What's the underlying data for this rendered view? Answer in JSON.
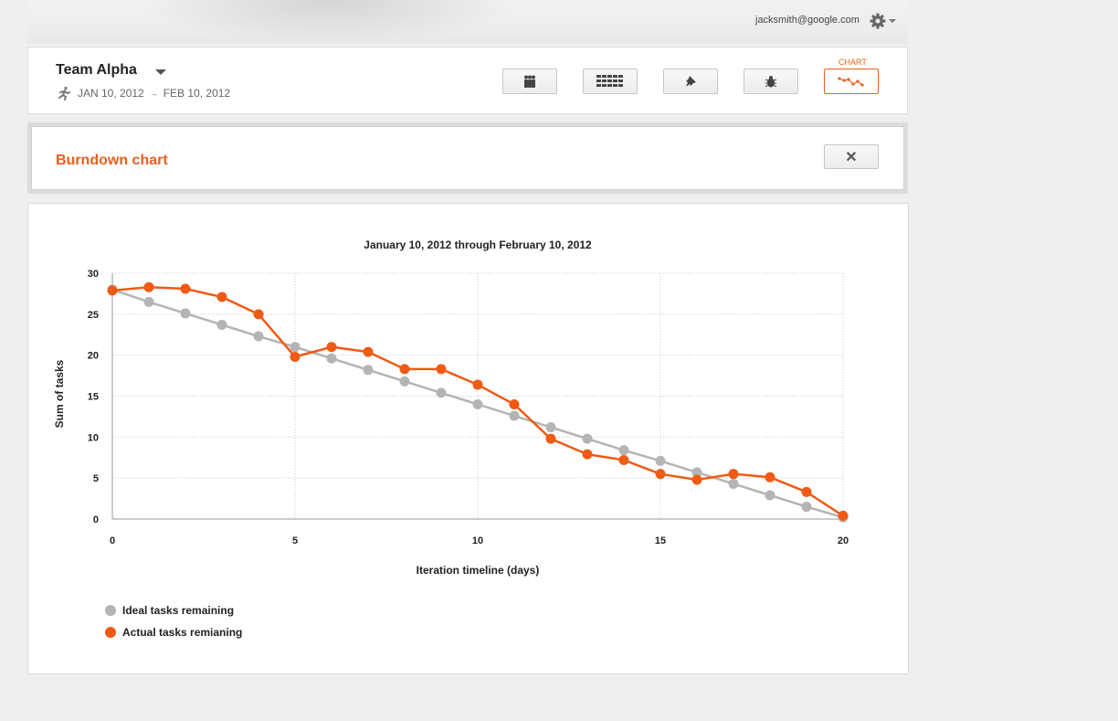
{
  "header": {
    "account_email": "jacksmith@google.com"
  },
  "project": {
    "team_name": "Team Alpha",
    "start_date": "JAN 10, 2012",
    "end_date": "FEB 10, 2012",
    "active_tool_label": "CHART"
  },
  "panel": {
    "title": "Burndown chart",
    "close_symbol": "✕"
  },
  "colors": {
    "accent": "#e8601c",
    "ideal": "#b4b4b4",
    "actual": "#f05a14"
  },
  "chart_data": {
    "type": "line",
    "title": "January 10, 2012 through February 10, 2012",
    "xlabel": "Iteration timeline (days)",
    "ylabel": "Sum of tasks",
    "xlim": [
      0,
      20
    ],
    "ylim": [
      0,
      30
    ],
    "xticks": [
      0,
      5,
      10,
      15,
      20
    ],
    "yticks": [
      0,
      5,
      10,
      15,
      20,
      25,
      30
    ],
    "grid": true,
    "legend_position": "bottom-left",
    "x": [
      0,
      1,
      2,
      3,
      4,
      5,
      6,
      7,
      8,
      9,
      10,
      11,
      12,
      13,
      14,
      15,
      16,
      17,
      18,
      19,
      20
    ],
    "series": [
      {
        "name": "Ideal tasks remaining",
        "values": [
          28,
          26.5,
          25.1,
          23.7,
          22.3,
          21,
          19.6,
          18.2,
          16.8,
          15.4,
          14,
          12.6,
          11.2,
          9.8,
          8.4,
          7.1,
          5.7,
          4.3,
          2.9,
          1.5,
          0.2
        ]
      },
      {
        "name": "Actual tasks remianing",
        "values": [
          27.9,
          28.3,
          28.1,
          27.1,
          25,
          19.8,
          21,
          20.4,
          18.3,
          18.3,
          16.4,
          14,
          9.8,
          7.9,
          7.2,
          5.5,
          4.8,
          5.5,
          5.1,
          3.3,
          0.4
        ]
      }
    ]
  }
}
